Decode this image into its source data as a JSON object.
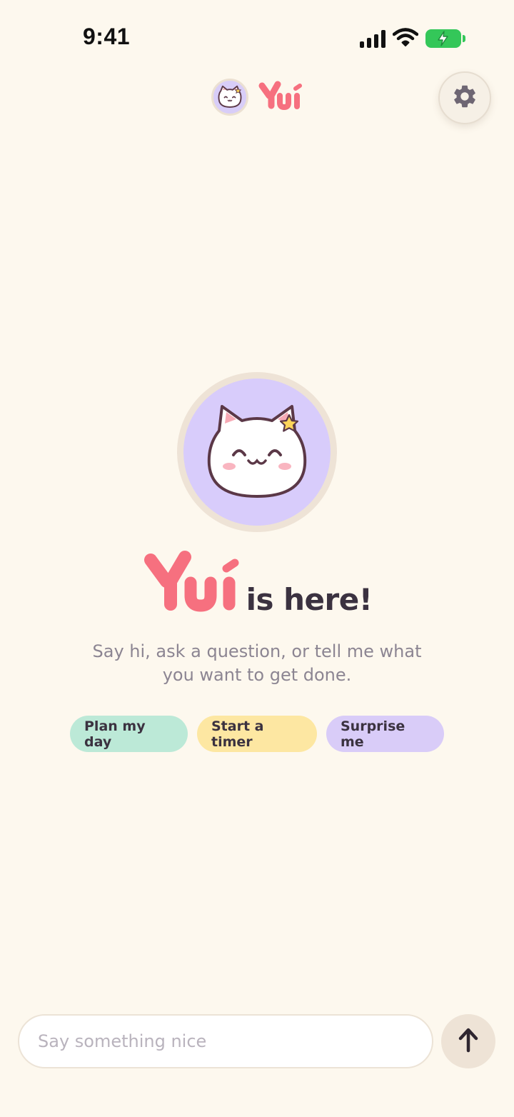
{
  "status_bar": {
    "time": "9:41"
  },
  "header": {
    "app_name": "Yui"
  },
  "hero": {
    "title_brand": "Yui",
    "title_suffix": "is here!",
    "subtitle": "Say hi, ask a question, or tell me what you want to get done."
  },
  "chips": [
    {
      "label": "Plan my day",
      "color": "#bce9d7"
    },
    {
      "label": "Start a timer",
      "color": "#fde7a2"
    },
    {
      "label": "Surprise me",
      "color": "#d9ccf8"
    }
  ],
  "composer": {
    "placeholder": "Say something nice"
  },
  "colors": {
    "background": "#fdf8ee",
    "brand": "#f6707f",
    "avatar_bg": "#d8ccfb",
    "battery": "#34c759"
  },
  "icons": [
    "signal-icon",
    "wifi-icon",
    "battery-charging-icon",
    "cat-mascot-icon",
    "gear-icon",
    "arrow-up-icon"
  ]
}
